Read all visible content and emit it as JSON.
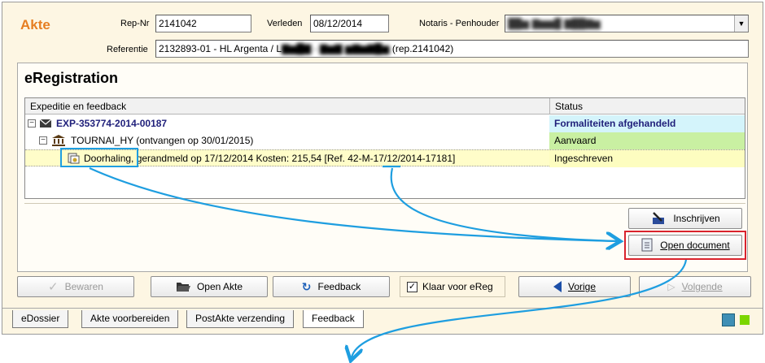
{
  "header": {
    "title": "Akte",
    "rep_nr_label": "Rep-Nr",
    "rep_nr_value": "2141042",
    "verleden_label": "Verleden",
    "verleden_value": "08/12/2014",
    "notaris_label": "Notaris - Penhouder",
    "referentie_label": "Referentie",
    "referentie_prefix": "2132893-01 - HL Argenta / L",
    "referentie_suffix": "(rep.2141042)"
  },
  "panel": {
    "title": "eRegistration",
    "col_left": "Expeditie en feedback",
    "col_right": "Status",
    "rows": [
      {
        "name": "EXP-353774-2014-00187",
        "status": "Formaliteiten afgehandeld",
        "status_color": "#d4f4fb"
      },
      {
        "name": "TOURNAI_HY (ontvangen op 30/01/2015)",
        "status": "Aanvaard",
        "status_color": "#c9f0a2"
      },
      {
        "name_a": "Doorhaling,",
        "name_b": " gerandmeld op 17/12/2014 Kosten: 215,54  [Ref. 42-M-17/12/2014-17181]",
        "status": "Ingeschreven",
        "status_color": "#fdfdc0"
      }
    ],
    "inschrijven_label": "Inschrijven",
    "open_document_label": "Open document"
  },
  "toolbar": {
    "bewaren_label": "Bewaren",
    "open_akte_label": "Open Akte",
    "feedback_label": "Feedback",
    "klaar_label": "Klaar voor eReg",
    "vorige_label": "Vorige",
    "volgende_label": "Volgende"
  },
  "tabs": [
    "eDossier",
    "Akte voorbereiden",
    "PostAkte verzending",
    "Feedback"
  ],
  "colors": {
    "accent": "#e67e22",
    "highlight_red": "#d9232d",
    "annotation_blue": "#1e9ee0",
    "link_navy": "#1f1f7a"
  }
}
